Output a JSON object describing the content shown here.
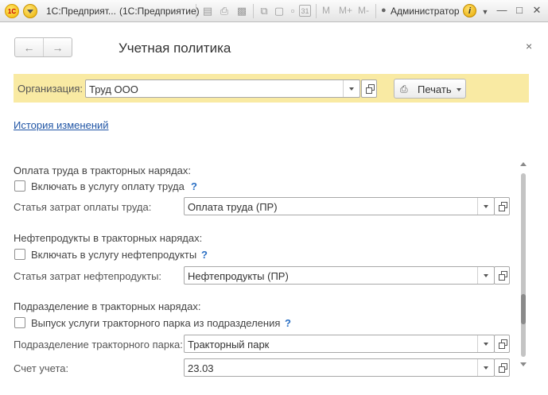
{
  "titlebar": {
    "logo_text": "1С",
    "tab_title": "1С:Предприят...",
    "window_title": "(1С:Предприятие)",
    "icons": [
      "save-icon",
      "print-icon",
      "preview-icon",
      "copy-icon",
      "cut-icon",
      "paste-icon",
      "calendar-icon"
    ],
    "calendar_text": "31",
    "m_labels": [
      "M",
      "M+",
      "M-"
    ],
    "user_name": "Администратор",
    "info_text": "i",
    "window_controls": [
      "minimize-icon",
      "maximize-icon",
      "close-icon"
    ]
  },
  "form": {
    "title": "Учетная политика",
    "close_glyph": "×",
    "organization": {
      "label": "Организация:",
      "value": "Труд ООО"
    },
    "print_button": "Печать",
    "history_link": "История изменений",
    "sections": [
      {
        "heading": "Оплата труда в тракторных нарядах:",
        "checkbox_label": "Включать в услугу оплату труда",
        "checked": false,
        "help": "?",
        "field_label": "Статья затрат оплаты труда:",
        "field_value": "Оплата труда (ПР)"
      },
      {
        "heading": "Нефтепродукты в тракторных нарядах:",
        "checkbox_label": "Включать в услугу нефтепродукты",
        "checked": false,
        "help": "?",
        "field_label": "Статья затрат нефтепродукты:",
        "field_value": "Нефтепродукты (ПР)"
      },
      {
        "heading": "Подразделение в тракторных нарядах:",
        "checkbox_label": "Выпуск услуги тракторного парка из подразделения",
        "checked": false,
        "help": "?",
        "field_label": "Подразделение тракторного парка:",
        "field_value": "Тракторный парк",
        "field2_label": "Счет учета:",
        "field2_value": "23.03"
      }
    ]
  },
  "colors": {
    "org_panel_bg": "#f9eaa3",
    "link": "#2055a5",
    "help": "#2a6fc4"
  }
}
